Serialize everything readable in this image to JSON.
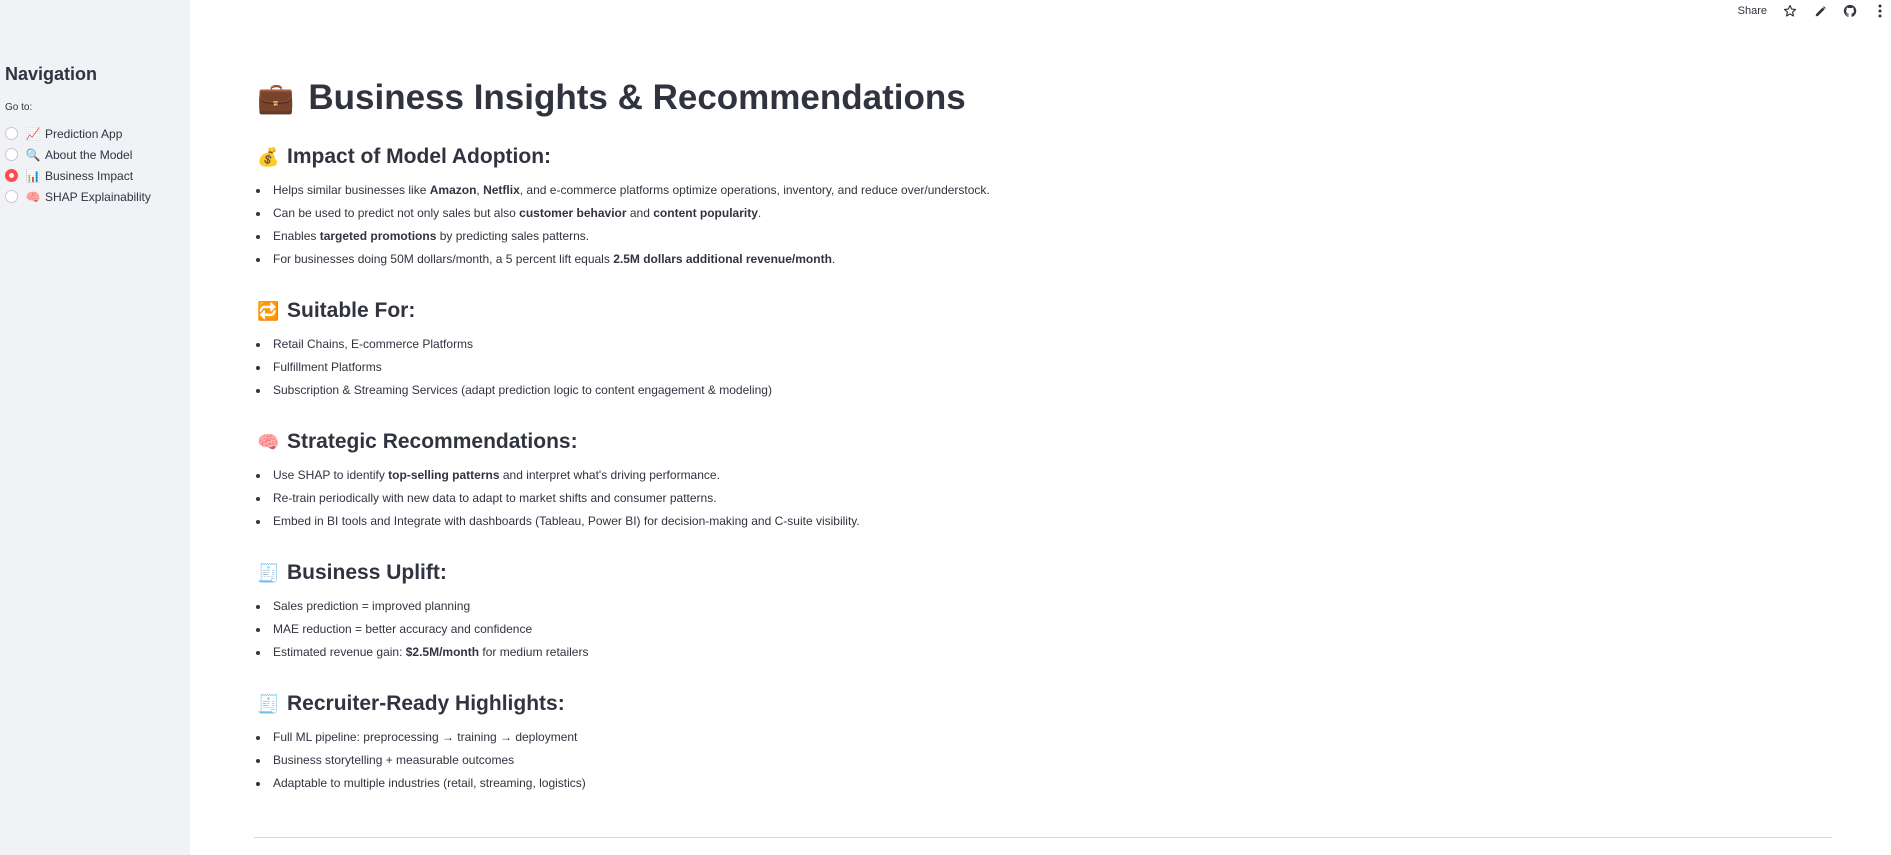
{
  "sidebar": {
    "title": "Navigation",
    "goto_label": "Go to:",
    "items": [
      {
        "emoji": "📈",
        "label": "Prediction App",
        "checked": false
      },
      {
        "emoji": "🔍",
        "label": "About the Model",
        "checked": false
      },
      {
        "emoji": "📊",
        "label": "Business Impact",
        "checked": true
      },
      {
        "emoji": "🧠",
        "label": "SHAP Explainability",
        "checked": false
      }
    ]
  },
  "toolbar": {
    "share_label": "Share",
    "icons": [
      "star-icon",
      "pencil-icon",
      "github-icon",
      "more-vertical-icon"
    ]
  },
  "page": {
    "title_emoji": "💼",
    "title": "Business Insights & Recommendations"
  },
  "sections": [
    {
      "emoji": "💰",
      "heading": "Impact of Model Adoption:",
      "bullets": [
        [
          {
            "t": "Helps similar businesses like "
          },
          {
            "t": "Amazon",
            "b": true
          },
          {
            "t": ", "
          },
          {
            "t": "Netflix",
            "b": true
          },
          {
            "t": ", and e-commerce platforms optimize operations, inventory, and reduce over/understock."
          }
        ],
        [
          {
            "t": "Can be used to predict not only sales but also "
          },
          {
            "t": "customer behavior",
            "b": true
          },
          {
            "t": " and "
          },
          {
            "t": "content popularity",
            "b": true
          },
          {
            "t": "."
          }
        ],
        [
          {
            "t": "Enables "
          },
          {
            "t": "targeted promotions",
            "b": true
          },
          {
            "t": " by predicting sales patterns."
          }
        ],
        [
          {
            "t": "For businesses doing 50M dollars/month, a 5 percent lift equals "
          },
          {
            "t": "2.5M dollars additional revenue/month",
            "b": true
          },
          {
            "t": "."
          }
        ]
      ]
    },
    {
      "emoji": "🔁",
      "heading": "Suitable For:",
      "bullets": [
        [
          {
            "t": "Retail Chains, E-commerce Platforms"
          }
        ],
        [
          {
            "t": "Fulfillment Platforms"
          }
        ],
        [
          {
            "t": "Subscription & Streaming Services (adapt prediction logic to content engagement & modeling)"
          }
        ]
      ]
    },
    {
      "emoji": "🧠",
      "heading": "Strategic Recommendations:",
      "bullets": [
        [
          {
            "t": "Use SHAP to identify "
          },
          {
            "t": "top-selling patterns",
            "b": true
          },
          {
            "t": " and interpret what's driving performance."
          }
        ],
        [
          {
            "t": "Re-train periodically with new data to adapt to market shifts and consumer patterns."
          }
        ],
        [
          {
            "t": "Embed in BI tools and Integrate with dashboards (Tableau, Power BI) for decision-making and C-suite visibility."
          }
        ]
      ]
    },
    {
      "emoji": "🧾",
      "heading": "Business Uplift:",
      "bullets": [
        [
          {
            "t": "Sales prediction = improved planning"
          }
        ],
        [
          {
            "t": "MAE reduction = better accuracy and confidence"
          }
        ],
        [
          {
            "t": "Estimated revenue gain: "
          },
          {
            "t": "$2.5M/month",
            "b": true
          },
          {
            "t": " for medium retailers"
          }
        ]
      ]
    },
    {
      "emoji": "🧾",
      "heading": "Recruiter-Ready Highlights:",
      "bullets": [
        [
          {
            "t": "Full ML pipeline: preprocessing → training → deployment"
          }
        ],
        [
          {
            "t": "Business storytelling + measurable outcomes"
          }
        ],
        [
          {
            "t": "Adaptable to multiple industries (retail, streaming, logistics)"
          }
        ]
      ]
    }
  ],
  "colors": {
    "sidebar_bg": "#f0f2f6",
    "text": "#31333f",
    "accent": "#ff4b4b"
  }
}
